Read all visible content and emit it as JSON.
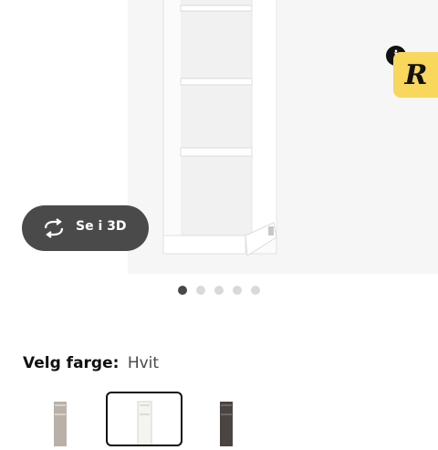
{
  "gallery": {
    "view3d_label": "Se i 3D",
    "view3d_icon": "rotate-3d-icon",
    "dot_count": 5,
    "active_dot": 1
  },
  "badge": {
    "letter": "R",
    "info_label": "i",
    "color": "#f9d65c"
  },
  "color_selector": {
    "label": "Velg farge:",
    "selected": "Hvit",
    "swatches": [
      {
        "color": "#b8b0a8",
        "selected": false
      },
      {
        "color": "#f3f3f0",
        "selected": true
      },
      {
        "color": "#4a4542",
        "selected": false
      }
    ]
  }
}
